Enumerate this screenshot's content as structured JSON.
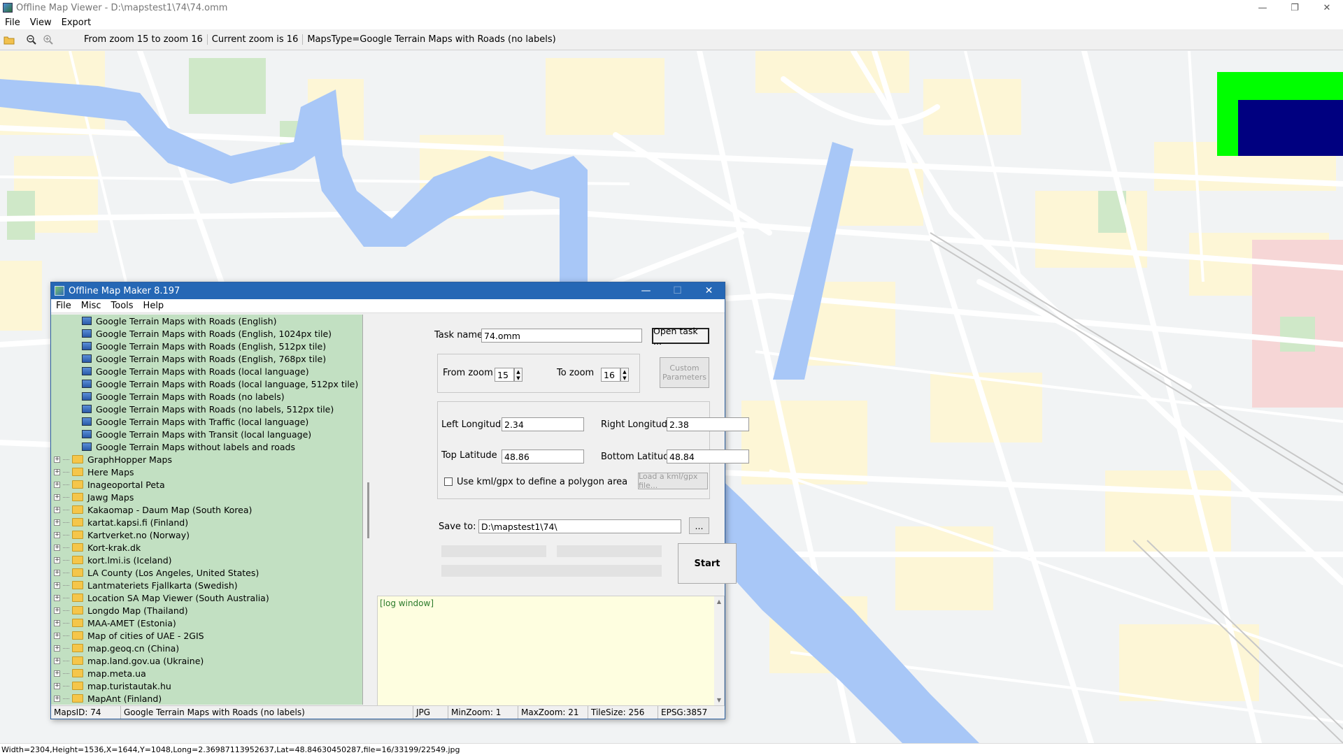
{
  "window": {
    "title": "Offline Map Viewer - D:\\mapstest1\\74\\74.omm",
    "controls": [
      "—",
      "❐",
      "✕"
    ]
  },
  "menu": [
    "File",
    "View",
    "Export"
  ],
  "toolbar": {
    "zoom_range": "From zoom 15 to zoom 16",
    "current_zoom": "Current zoom is 16",
    "maps_type": "MapsType=Google Terrain Maps with Roads (no labels)"
  },
  "status": "Width=2304,Height=1536,X=1644,Y=1048,Long=2.36987113952637,Lat=48.84630450287,file=16/33199/22549.jpg",
  "dialog": {
    "title": "Offline Map Maker 8.197",
    "controls": [
      "—",
      "☐",
      "✕"
    ],
    "menu": [
      "File",
      "Misc",
      "Tools",
      "Help"
    ],
    "tree_children": [
      "Google Terrain Maps with Roads (English)",
      "Google Terrain Maps with Roads (English, 1024px tile)",
      "Google Terrain Maps with Roads (English, 512px tile)",
      "Google Terrain Maps with Roads (English, 768px tile)",
      "Google Terrain Maps with Roads (local language)",
      "Google Terrain Maps with Roads (local language, 512px tile)",
      "Google Terrain Maps with Roads (no labels)",
      "Google Terrain Maps with Roads (no labels, 512px tile)",
      "Google Terrain Maps with Traffic (local language)",
      "Google Terrain Maps with Transit (local language)",
      "Google Terrain Maps without labels and roads"
    ],
    "tree_folders": [
      "GraphHopper Maps",
      "Here Maps",
      "Inageoportal Peta",
      "Jawg Maps",
      "Kakaomap - Daum Map (South Korea)",
      "kartat.kapsi.fi (Finland)",
      "Kartverket.no (Norway)",
      "Kort-krak.dk",
      "kort.lmi.is (Iceland)",
      "LA County (Los Angeles, United States)",
      "Lantmateriets Fjallkarta (Swedish)",
      "Location SA Map Viewer (South Australia)",
      "Longdo Map (Thailand)",
      "MAA-AMET (Estonia)",
      "Map of cities of UAE - 2GIS",
      "map.geoq.cn (China)",
      "map.land.gov.ua (Ukraine)",
      "map.meta.ua",
      "map.turistautak.hu",
      "MapAnt (Finland)"
    ],
    "task_name_label": "Task name",
    "task_name_value": "74.omm",
    "open_task": "Open task ...",
    "from_zoom_label": "From zoom",
    "from_zoom_value": "15",
    "to_zoom_label": "To zoom",
    "to_zoom_value": "16",
    "custom_params": "Custom Parameters",
    "left_lon_label": "Left Longitude",
    "left_lon_value": "2.34",
    "right_lon_label": "Right Longitude",
    "right_lon_value": "2.38",
    "top_lat_label": "Top Latitude",
    "top_lat_value": "48.86",
    "bottom_lat_label": "Bottom Latitude",
    "bottom_lat_value": "48.84",
    "use_kml_label": "Use kml/gpx to define a polygon area",
    "load_kml": "Load a kml/gpx file...",
    "save_to_label": "Save to:",
    "save_to_value": "D:\\mapstest1\\74\\",
    "browse": "...",
    "start": "Start",
    "log": "[log window]",
    "status": {
      "maps_id": "MapsID: 74",
      "map_name": "Google Terrain Maps with Roads (no labels)",
      "format": "JPG",
      "min_zoom": "MinZoom: 1",
      "max_zoom": "MaxZoom: 21",
      "tile_size": "TileSize: 256",
      "epsg": "EPSG:3857"
    }
  },
  "colors": {
    "water": "#a8c7f7",
    "block": "#fdf6d6",
    "park": "#cfe8c8",
    "road": "#ffffff",
    "tree_bg": "#c2e0c2",
    "overview_green": "#00ff00",
    "overview_navy": "#000080"
  }
}
